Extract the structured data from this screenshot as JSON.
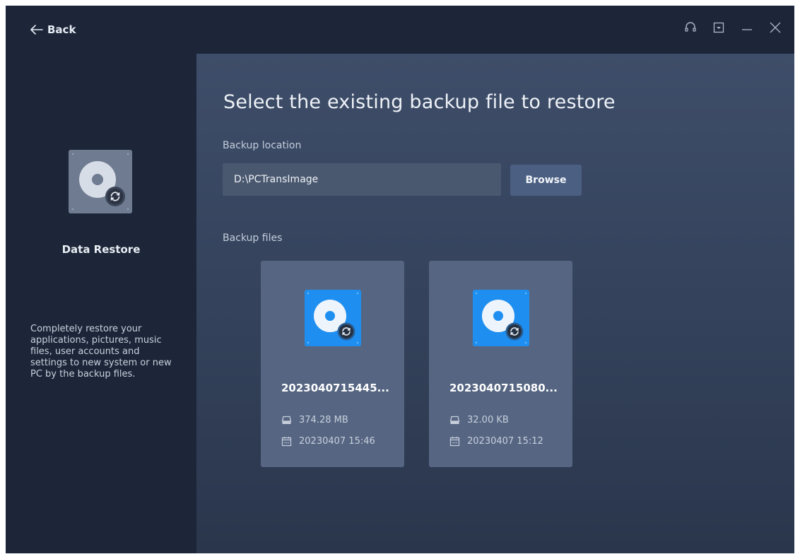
{
  "titlebar": {
    "back_label": "Back",
    "icons": [
      "headset-icon",
      "dropdown-menu-icon",
      "minimize-icon",
      "close-icon"
    ]
  },
  "sidebar": {
    "icon": "disk-restore-icon",
    "title": "Data Restore",
    "description": "Completely restore your applications, pictures, music files, user accounts and settings to new system or new PC by the backup files."
  },
  "main": {
    "title": "Select the existing backup file to restore",
    "location_label": "Backup location",
    "location_value": "D:\\PCTransImage",
    "browse_label": "Browse",
    "files_label": "Backup files",
    "files": [
      {
        "name": "2023040715445...",
        "size": "374.28 MB",
        "date": "20230407 15:46"
      },
      {
        "name": "2023040715080...",
        "size": "32.00 KB",
        "date": "20230407 15:12"
      }
    ]
  },
  "colors": {
    "window_bg": "#1c2638",
    "main_bg": "#3e4d69",
    "card_bg": "#566682",
    "accent_blue": "#1e8ff0",
    "browse_btn": "#4b5f82"
  }
}
